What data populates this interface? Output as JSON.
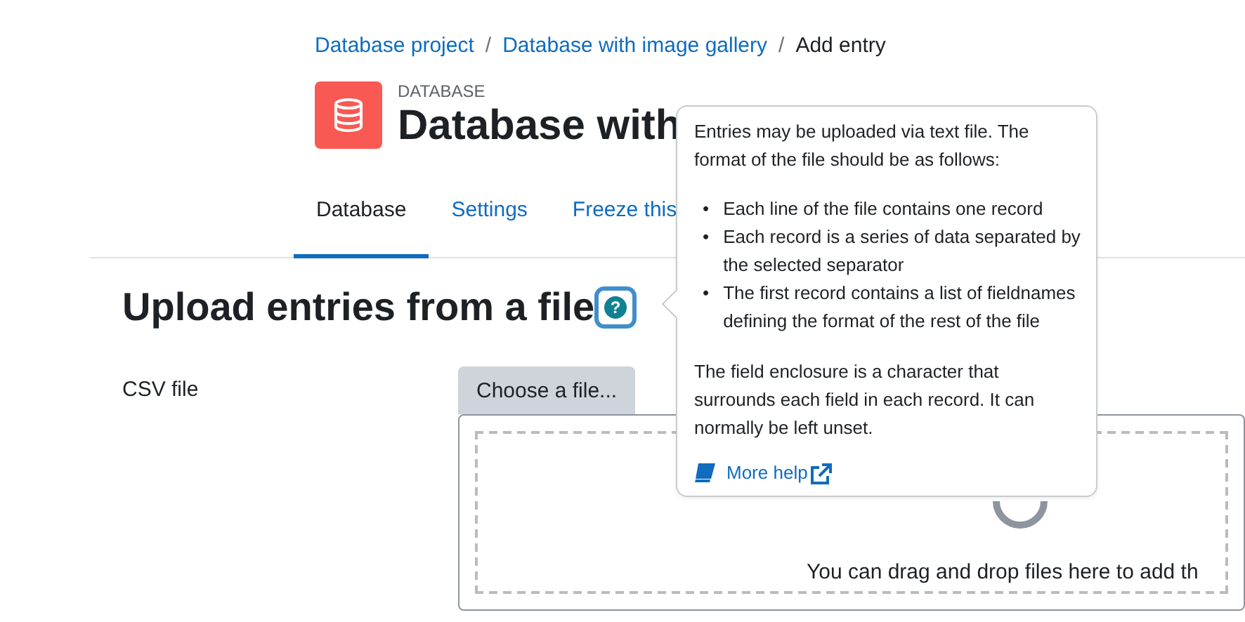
{
  "breadcrumb": [
    {
      "label": "Database project",
      "kind": "link",
      "separator": "/"
    },
    {
      "label": "Database with image gallery",
      "kind": "link",
      "separator": "/"
    },
    {
      "label": "Add entry",
      "kind": "current"
    }
  ],
  "header": {
    "category": "DATABASE",
    "title": "Database with"
  },
  "tabs": [
    {
      "label": "Database",
      "selected": true
    },
    {
      "label": "Settings",
      "selected": false
    },
    {
      "label": "Freeze this",
      "selected": false
    }
  ],
  "section": {
    "heading": "Upload entries from a file",
    "help_icon": "?"
  },
  "form": {
    "field_label": "CSV file",
    "button": "Choose a file...",
    "dropzone_text": "You can drag and drop files here to add th"
  },
  "popover": {
    "intro": "Entries may be uploaded via text file. The format of the file should be as follows:",
    "bullets": [
      {
        "marker": "•",
        "text": "Each line of the file contains one record"
      },
      {
        "marker": "•",
        "text": "Each record is a series of data separated by the selected separator"
      },
      {
        "marker": "•",
        "text": "The first record contains a list of fieldnames defining the format of the rest of the file"
      }
    ],
    "note": "The field enclosure is a character that surrounds each field in each record. It can normally be left unset.",
    "link": "More help"
  }
}
